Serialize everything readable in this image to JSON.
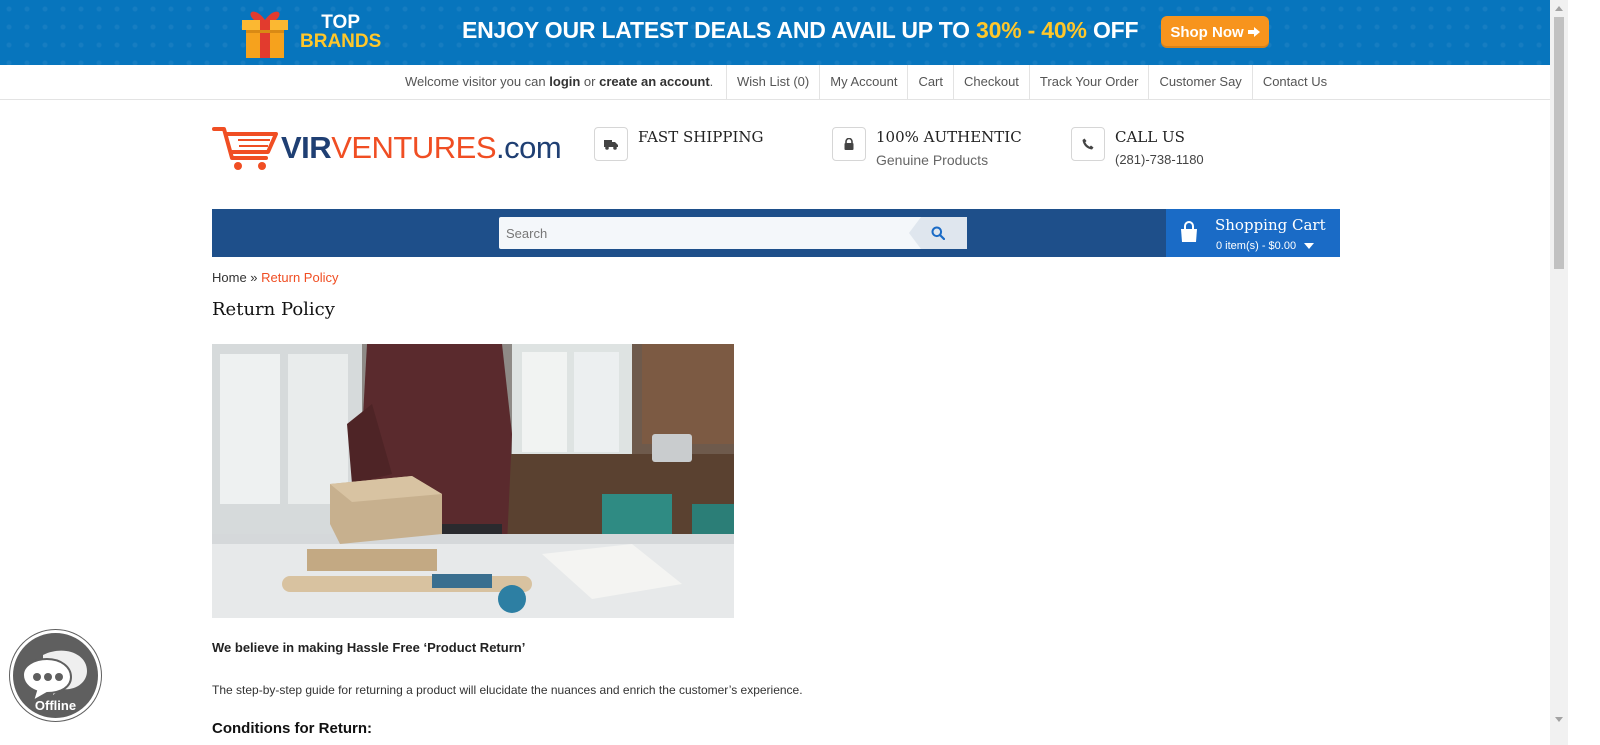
{
  "promo": {
    "brand_line1": "TOP",
    "brand_line2": "BRANDS",
    "text_main": "ENJOY OUR LATEST DEALS AND AVAIL UP TO ",
    "text_highlight": "30% - 40%",
    "text_end": " OFF",
    "shop_now": "Shop Now",
    "colors": {
      "background": "#0775bd",
      "highlight": "#ffc72a",
      "button": "#f7941d"
    }
  },
  "toplinks": {
    "welcome_prefix": "Welcome visitor you can ",
    "login": "login",
    "or": " or ",
    "create_account": "create an account",
    "period": ".",
    "items": [
      "Wish List (0)",
      "My Account",
      "Cart",
      "Checkout",
      "Track Your Order",
      "Customer Say",
      "Contact Us"
    ]
  },
  "header": {
    "logo": {
      "part1": "VIR",
      "part2": "VENTURES",
      "part3": ".com",
      "icon": "shopping-cart-logo-icon"
    },
    "features": [
      {
        "icon": "truck-icon",
        "title": "FAST SHIPPING",
        "subtitle": ""
      },
      {
        "icon": "lock-icon",
        "title": "100% AUTHENTIC",
        "subtitle": "Genuine Products"
      },
      {
        "icon": "phone-icon",
        "title": "CALL US",
        "subtitle": "(281)-738-1180"
      }
    ]
  },
  "nav": {
    "search_placeholder": "Search",
    "search_icon": "search-icon",
    "cart_title": "Shopping Cart",
    "cart_summary": "0 item(s) - $0.00",
    "colors": {
      "bar": "#1e4f8a",
      "cart": "#1a6bc6"
    }
  },
  "breadcrumb": {
    "home": "Home",
    "separator": " » ",
    "current": "Return Policy"
  },
  "content": {
    "title": "Return Policy",
    "lead": "We believe in making Hassle Free ‘Product Return’",
    "paragraph": "The step-by-step guide for returning a product will elucidate the nuances and enrich the customer’s experience.",
    "subheading": "Conditions for Return:"
  },
  "chat": {
    "status": "Offline",
    "icon": "chat-bubbles-icon"
  }
}
